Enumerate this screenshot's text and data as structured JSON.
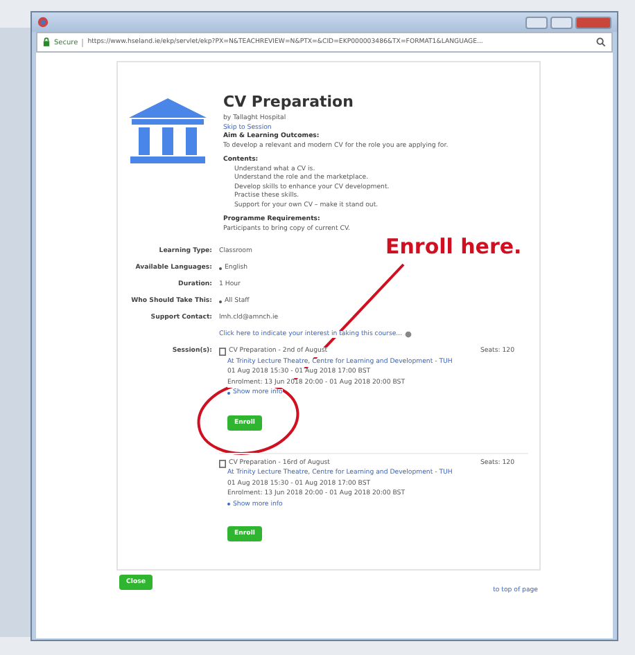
{
  "address_bar": {
    "secure": "Secure",
    "url": "https://www.hseland.ie/ekp/servlet/ekp?PX=N&TEACHREVIEW=N&PTX=&CID=EKP000003486&TX=FORMAT1&LANGUAGE..."
  },
  "course": {
    "title": "CV Preparation",
    "provider": "by Tallaght Hospital",
    "skip_link": "Skip to Session",
    "aims_heading": "Aim & Learning Outcomes:",
    "aims_text": "To develop a relevant and modern CV for the role you are applying for.",
    "contents_heading": "Contents:",
    "contents": [
      "Understand what a CV is.",
      "Understand the role and the marketplace.",
      "Develop skills to enhance your CV development.",
      "Practise these skills.",
      "Support for your own CV – make it stand out."
    ],
    "requirements_heading": "Programme Requirements:",
    "requirements_text": "Participants to bring copy of current CV."
  },
  "details": [
    {
      "label": "Learning Type:",
      "value": "Classroom",
      "bullet": false
    },
    {
      "label": "Available Languages:",
      "value": "English",
      "bullet": true
    },
    {
      "label": "Duration:",
      "value": "1 Hour",
      "bullet": false
    },
    {
      "label": "Who Should Take This:",
      "value": "All Staff",
      "bullet": true
    },
    {
      "label": "Support Contact:",
      "value": "lmh.cld@amnch.ie",
      "bullet": false
    }
  ],
  "interest_link": "Click here to indicate your interest in taking this course...",
  "sessions_label": "Session(s):",
  "sessions": [
    {
      "title": "CV Preparation - 2nd of August",
      "location": "At Trinity Lecture Theatre, Centre for Learning and Development - TUH",
      "time": "01 Aug 2018 15:30 - 01 Aug 2018 17:00 BST",
      "enrolment": "Enrolment: 13 Jun 2018 20:00 - 01 Aug 2018 20:00 BST",
      "more": "Show more info",
      "seats": "Seats: 120",
      "button": "Enroll"
    },
    {
      "title": "CV Preparation - 16rd of August",
      "location": "At Trinity Lecture Theatre, Centre for Learning and Development - TUH",
      "time": "01 Aug 2018 15:30 - 01 Aug 2018 17:00 BST",
      "enrolment": "Enrolment: 13 Jun 2018 20:00 - 01 Aug 2018 20:00 BST",
      "more": "Show more info",
      "seats": "Seats: 120",
      "button": "Enroll"
    }
  ],
  "close_button": "Close",
  "top_link": "to top of page",
  "annotation": {
    "text": "Enroll here."
  }
}
